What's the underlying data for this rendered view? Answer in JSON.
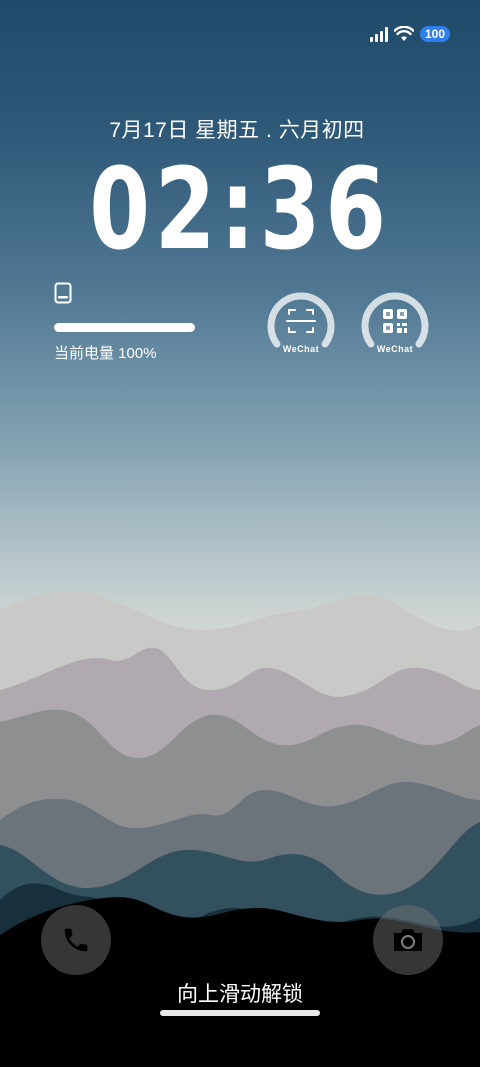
{
  "status_bar": {
    "battery_level": "100",
    "signal_icon": "cellular-signal-icon",
    "wifi_icon": "wifi-icon"
  },
  "lock_screen": {
    "date": "7月17日 星期五 . 六月初四",
    "time": "02:36",
    "battery_widget": {
      "label": "当前电量 100%",
      "level_percent": 100,
      "icon": "tablet-icon"
    },
    "widgets": [
      {
        "caption": "WeChat",
        "icon": "scan-icon"
      },
      {
        "caption": "WeChat",
        "icon": "qr-code-icon"
      }
    ],
    "unlock_hint": "向上滑动解锁"
  },
  "colors": {
    "badge": "#2f7ff0",
    "sky_top": "#204a6a",
    "ground": "#000000"
  }
}
